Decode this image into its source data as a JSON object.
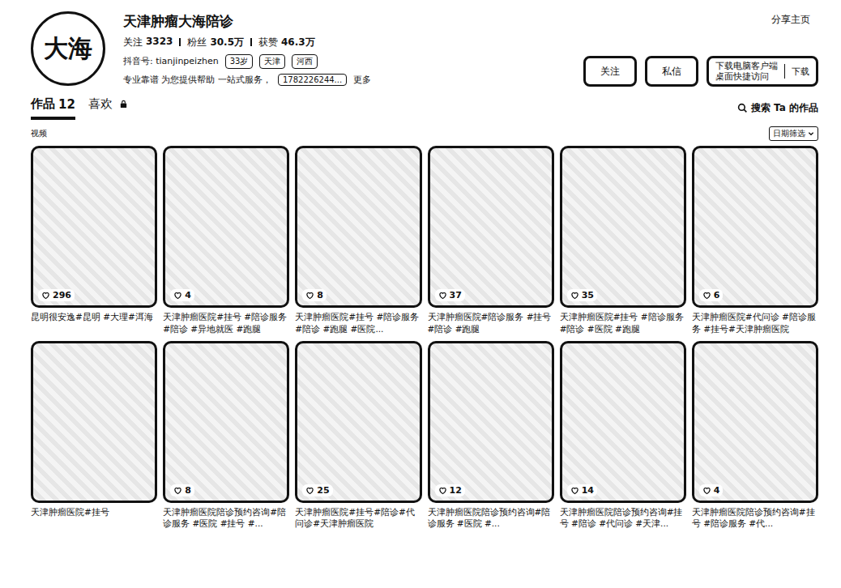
{
  "profile": {
    "avatar_text": "大海",
    "name": "天津肿瘤大海陪诊",
    "stats": [
      {
        "label": "关注",
        "value": "3323"
      },
      {
        "label": "粉丝",
        "value": "30.5万"
      },
      {
        "label": "获赞",
        "value": "46.3万"
      }
    ],
    "douyin_id": "抖音号: tianjinpeizhen",
    "tags": [
      "33岁",
      "天津",
      "河西"
    ],
    "bio": "专业靠谱 为您提供帮助 一站式服务，",
    "phone": "1782226244...",
    "more": "更多"
  },
  "actions": {
    "share": "分享主页",
    "follow": "关注",
    "message": "私信",
    "download_title": "下载电脑客户端",
    "download_sub": "桌面快捷访问",
    "download": "下载"
  },
  "tabs": [
    {
      "label": "作品",
      "count": "12",
      "selected": true,
      "locked": false
    },
    {
      "label": "喜欢",
      "count": "",
      "selected": false,
      "locked": true
    }
  ],
  "search": "搜索 Ta 的作品",
  "filter": {
    "category": "视频",
    "sort": "日期筛选"
  },
  "videos": [
    {
      "likes": "296",
      "caption": "昆明很安逸#昆明 #大理#洱海"
    },
    {
      "likes": "4",
      "caption": "天津肿瘤医院#挂号 #陪诊服务 #陪诊 #异地就医 #跑腿"
    },
    {
      "likes": "8",
      "caption": "天津肿瘤医院#挂号 #陪诊服务 #陪诊 #跑腿 #医院..."
    },
    {
      "likes": "37",
      "caption": "天津肿瘤医院#陪诊服务 #挂号 #陪诊 #跑腿"
    },
    {
      "likes": "35",
      "caption": "天津肿瘤医院#挂号 #陪诊服务 #陪诊 #医院 #跑腿"
    },
    {
      "likes": "6",
      "caption": "天津肿瘤医院#代问诊 #陪诊服务 #挂号#天津肿瘤医院"
    },
    {
      "likes": "",
      "caption": "天津肿瘤医院#挂号"
    },
    {
      "likes": "8",
      "caption": "天津肿瘤医院陪诊预约咨询#陪诊服务 #医院 #挂号 #..."
    },
    {
      "likes": "25",
      "caption": "天津肿瘤医院#挂号#陪诊#代问诊#天津肿瘤医院"
    },
    {
      "likes": "12",
      "caption": "天津肿瘤医院陪诊预约咨询#陪诊服务 #医院 #..."
    },
    {
      "likes": "14",
      "caption": "天津肿瘤医院陪诊预约咨询#挂号 #陪诊 #代问诊 #天津..."
    },
    {
      "likes": "4",
      "caption": "天津肿瘤医院陪诊预约咨询#挂号 #陪诊服务 #代..."
    }
  ]
}
